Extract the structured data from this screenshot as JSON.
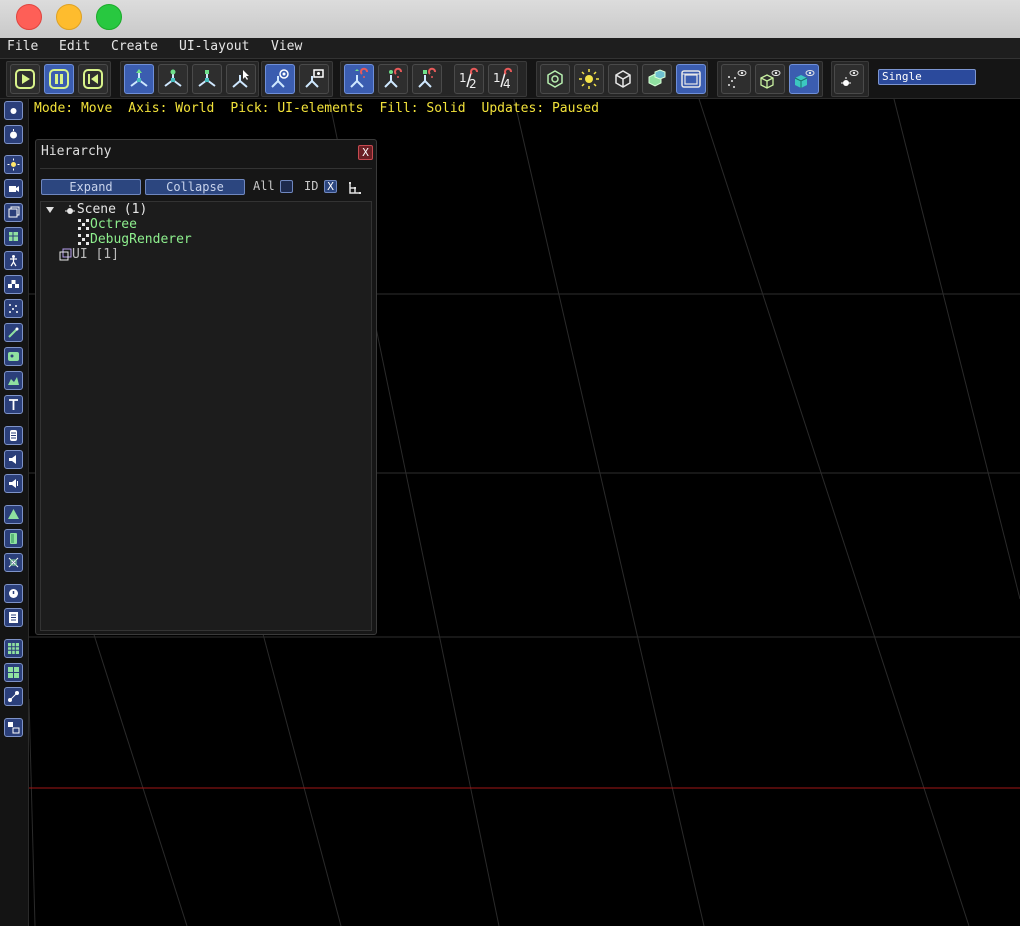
{
  "window": {
    "controls": [
      "close-button",
      "minimize-button",
      "zoom-button"
    ]
  },
  "menu": [
    "File",
    "Edit",
    "Create",
    "UI-layout",
    "View"
  ],
  "toolbar": {
    "viewport_mode": "Single",
    "accent_color": "#3b5db0"
  },
  "status": {
    "mode": "Mode: Move",
    "axis": "Axis: World",
    "pick": "Pick: UI-elements",
    "fill": "Fill: Solid",
    "updates": "Updates: Paused"
  },
  "hierarchy": {
    "title": "Hierarchy",
    "close": "X",
    "expand_label": "Expand",
    "collapse_label": "Collapse",
    "all_label": "All",
    "id_label": "ID",
    "id_check": "X",
    "tree": {
      "scene": "Scene (1)",
      "components": [
        "Octree",
        "DebugRenderer"
      ],
      "ui": "UI [1]"
    }
  }
}
